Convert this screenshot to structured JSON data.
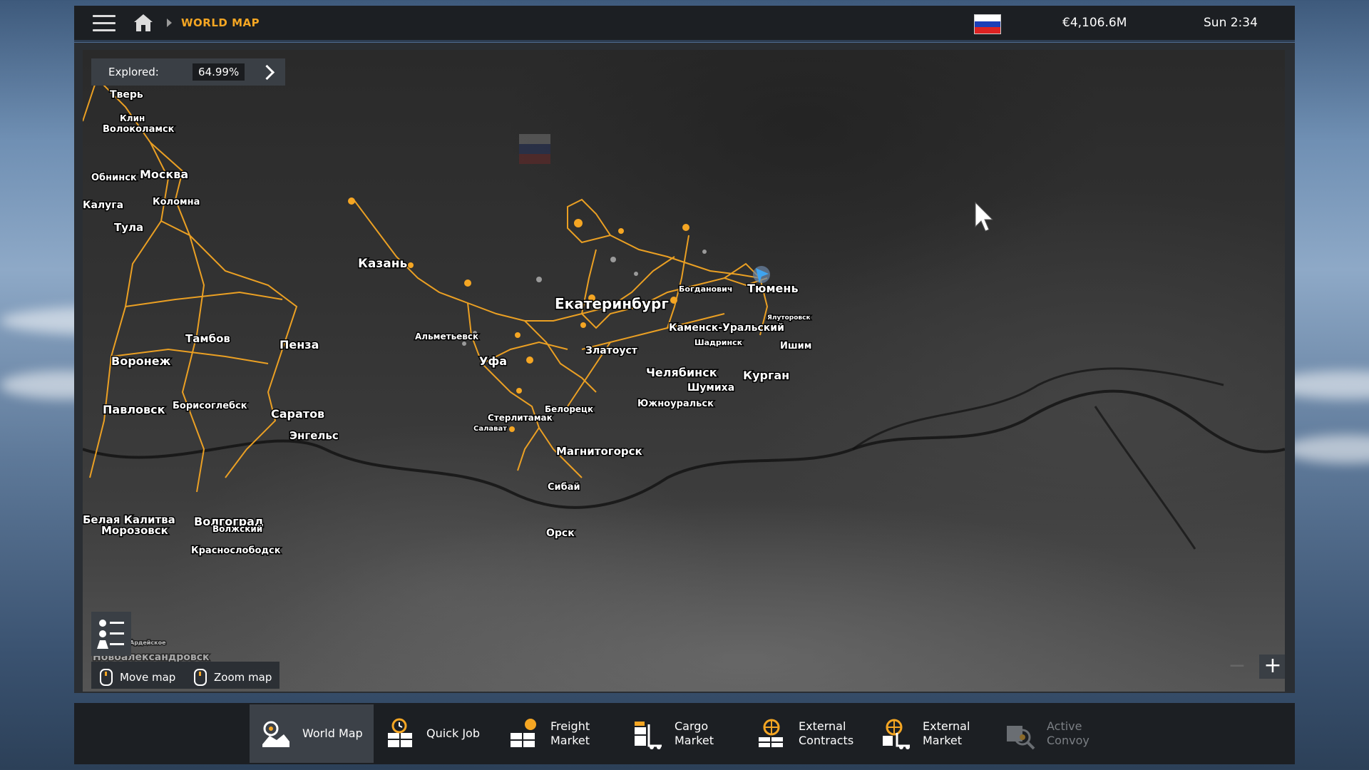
{
  "topbar": {
    "breadcrumb": "WORLD MAP",
    "money": "€4,106.6M",
    "clock": "Sun 2:34"
  },
  "map": {
    "explored_label": "Explored:",
    "explored_value": "64.99%",
    "hints": {
      "move": "Move map",
      "zoom": "Zoom map"
    },
    "cities": [
      {
        "name": "Тверь"
      },
      {
        "name": "Клин"
      },
      {
        "name": "Волоколамск"
      },
      {
        "name": "Обнинск"
      },
      {
        "name": "Москва"
      },
      {
        "name": "Калуга"
      },
      {
        "name": "Коломна"
      },
      {
        "name": "Тула"
      },
      {
        "name": "Тамбов"
      },
      {
        "name": "Пенза"
      },
      {
        "name": "Воронеж"
      },
      {
        "name": "Борисоглебск"
      },
      {
        "name": "Павловск"
      },
      {
        "name": "Саратов"
      },
      {
        "name": "Энгельс"
      },
      {
        "name": "Белая Калитва"
      },
      {
        "name": "Морозовск"
      },
      {
        "name": "Волгоград"
      },
      {
        "name": "Волжский"
      },
      {
        "name": "Краснослободск"
      },
      {
        "name": "Казань"
      },
      {
        "name": "Альметьевск"
      },
      {
        "name": "Уфа"
      },
      {
        "name": "Стерлитамак"
      },
      {
        "name": "Салават"
      },
      {
        "name": "Белорецк"
      },
      {
        "name": "Магнитогорск"
      },
      {
        "name": "Сибай"
      },
      {
        "name": "Орск"
      },
      {
        "name": "Екатеринбург"
      },
      {
        "name": "Богданович"
      },
      {
        "name": "Тюмень"
      },
      {
        "name": "Ялуторовск"
      },
      {
        "name": "Каменск-Уральский"
      },
      {
        "name": "Шадринск"
      },
      {
        "name": "Златоуст"
      },
      {
        "name": "Челябинск"
      },
      {
        "name": "Шумиха"
      },
      {
        "name": "Курган"
      },
      {
        "name": "Южноуральск"
      },
      {
        "name": "Ишим"
      },
      {
        "name": "Новоалександровск"
      },
      {
        "name": "Ардейское"
      }
    ]
  },
  "tabs": [
    {
      "label1": "World Map",
      "label2": ""
    },
    {
      "label1": "Quick Job",
      "label2": ""
    },
    {
      "label1": "Freight",
      "label2": "Market"
    },
    {
      "label1": "Cargo",
      "label2": "Market"
    },
    {
      "label1": "External",
      "label2": "Contracts"
    },
    {
      "label1": "External",
      "label2": "Market"
    },
    {
      "label1": "Active",
      "label2": "Convoy"
    }
  ],
  "colors": {
    "accent": "#f5a623",
    "road": "#f5a623",
    "panel": "#1c1f23"
  }
}
